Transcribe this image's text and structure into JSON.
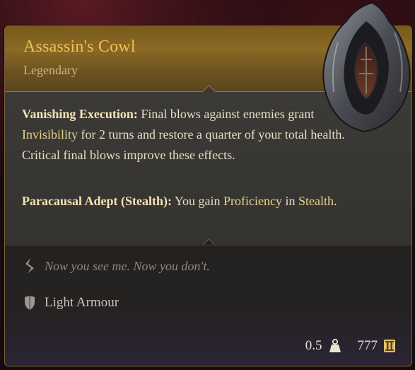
{
  "item": {
    "name": "Assassin's Cowl",
    "rarity": "Legendary"
  },
  "effects": [
    {
      "name": "Vanishing Execution:",
      "text_a": " Final blows against enemies grant ",
      "keyword": "Invisibility",
      "text_b": " for 2 turns and restore a quarter of your total health. Critical final blows improve these effects."
    },
    {
      "name": "Paracausal Adept (Stealth):",
      "text_a": " You gain ",
      "keyword": "Proficiency",
      "text_b": " in ",
      "keyword2": "Stealth",
      "text_c": "."
    }
  ],
  "flavor_text": "Now you see me. Now you don't.",
  "armour_type": "Light Armour",
  "weight": "0.5",
  "price": "777",
  "icons": [
    "quill-icon",
    "shield-icon",
    "weight-icon",
    "gold-coin-icon"
  ]
}
